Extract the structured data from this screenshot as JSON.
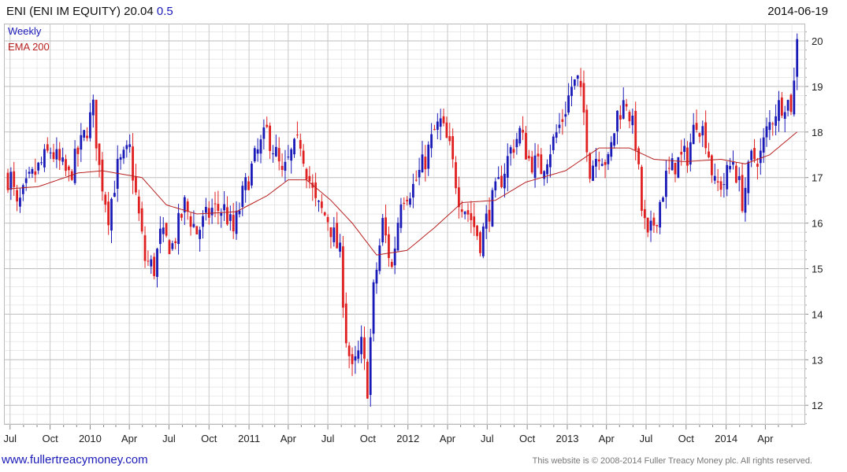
{
  "header": {
    "title": "ENI (ENI IM EQUITY) 20.04",
    "change": "0.5",
    "date": "2014-06-19"
  },
  "legend": {
    "weekly": "Weekly",
    "ema": "EMA 200"
  },
  "footer": {
    "website": "www.fullertreacymoney.com",
    "copyright": "This website is © 2008-2014 Fuller Treacy Money plc. All rights reserved."
  },
  "colors": {
    "up": "#1a1ab8",
    "down": "#e02020",
    "ema": "#b82020",
    "grid": "#dcdcdc"
  },
  "chart_data": {
    "type": "candlestick",
    "title": "ENI (ENI IM EQUITY) 20.04",
    "ylim": [
      11.5,
      20.3
    ],
    "y_ticks": [
      12,
      13,
      14,
      15,
      16,
      17,
      18,
      19,
      20
    ],
    "x_tick_labels": [
      "Jul",
      "Oct",
      "2010",
      "Apr",
      "Jul",
      "Oct",
      "2011",
      "Apr",
      "Jul",
      "Oct",
      "2012",
      "Apr",
      "Jul",
      "Oct",
      "2013",
      "Apr",
      "Jul",
      "Oct",
      "2014",
      "Apr"
    ],
    "x_range": [
      "2009-06-26",
      "2014-06-19"
    ],
    "grid": true,
    "legend_position": "top-left",
    "price_path": [
      [
        "2009-07-03",
        17.0
      ],
      [
        "2009-07-17",
        16.3
      ],
      [
        "2009-08-14",
        16.9
      ],
      [
        "2009-09-04",
        17.2
      ],
      [
        "2009-10-02",
        17.6
      ],
      [
        "2009-10-16",
        17.4
      ],
      [
        "2009-11-13",
        17.0
      ],
      [
        "2009-12-18",
        17.9
      ],
      [
        "2010-01-08",
        18.5
      ],
      [
        "2010-01-22",
        17.2
      ],
      [
        "2010-02-12",
        16.2
      ],
      [
        "2010-03-05",
        17.2
      ],
      [
        "2010-04-02",
        17.6
      ],
      [
        "2010-04-16",
        16.6
      ],
      [
        "2010-05-07",
        15.2
      ],
      [
        "2010-05-28",
        15.0
      ],
      [
        "2010-06-11",
        15.7
      ],
      [
        "2010-07-09",
        15.5
      ],
      [
        "2010-08-06",
        16.4
      ],
      [
        "2010-09-03",
        15.8
      ],
      [
        "2010-10-08",
        16.3
      ],
      [
        "2010-11-05",
        16.3
      ],
      [
        "2010-11-26",
        15.8
      ],
      [
        "2010-12-17",
        16.6
      ],
      [
        "2011-01-14",
        17.4
      ],
      [
        "2011-02-11",
        18.0
      ],
      [
        "2011-03-04",
        17.5
      ],
      [
        "2011-03-18",
        17.0
      ],
      [
        "2011-04-08",
        17.5
      ],
      [
        "2011-04-29",
        17.8
      ],
      [
        "2011-05-13",
        17.2
      ],
      [
        "2011-06-03",
        16.4
      ],
      [
        "2011-07-01",
        16.1
      ],
      [
        "2011-07-29",
        15.3
      ],
      [
        "2011-08-12",
        13.5
      ],
      [
        "2011-08-26",
        12.7
      ],
      [
        "2011-09-16",
        13.3
      ],
      [
        "2011-09-30",
        12.4
      ],
      [
        "2011-10-14",
        14.5
      ],
      [
        "2011-11-04",
        16.0
      ],
      [
        "2011-11-25",
        15.0
      ],
      [
        "2011-12-16",
        16.6
      ],
      [
        "2012-01-13",
        16.8
      ],
      [
        "2012-02-10",
        17.4
      ],
      [
        "2012-03-02",
        18.0
      ],
      [
        "2012-03-16",
        18.2
      ],
      [
        "2012-04-06",
        17.6
      ],
      [
        "2012-04-27",
        16.6
      ],
      [
        "2012-05-25",
        16.1
      ],
      [
        "2012-06-15",
        15.6
      ],
      [
        "2012-07-06",
        16.3
      ],
      [
        "2012-08-03",
        17.0
      ],
      [
        "2012-08-24",
        17.6
      ],
      [
        "2012-09-14",
        18.0
      ],
      [
        "2012-10-05",
        17.4
      ],
      [
        "2012-11-02",
        17.2
      ],
      [
        "2012-11-30",
        17.8
      ],
      [
        "2012-12-21",
        18.3
      ],
      [
        "2013-01-11",
        19.0
      ],
      [
        "2013-01-25",
        19.1
      ],
      [
        "2013-02-08",
        18.4
      ],
      [
        "2013-02-22",
        17.2
      ],
      [
        "2013-03-15",
        17.6
      ],
      [
        "2013-04-05",
        17.3
      ],
      [
        "2013-04-26",
        18.4
      ],
      [
        "2013-05-17",
        18.7
      ],
      [
        "2013-06-07",
        17.8
      ],
      [
        "2013-06-21",
        16.3
      ],
      [
        "2013-07-05",
        15.6
      ],
      [
        "2013-07-26",
        16.2
      ],
      [
        "2013-08-16",
        17.0
      ],
      [
        "2013-09-06",
        17.3
      ],
      [
        "2013-10-04",
        17.5
      ],
      [
        "2013-10-25",
        18.3
      ],
      [
        "2013-11-15",
        17.9
      ],
      [
        "2013-12-06",
        16.8
      ],
      [
        "2013-12-27",
        16.9
      ],
      [
        "2014-01-17",
        17.4
      ],
      [
        "2014-02-07",
        16.5
      ],
      [
        "2014-02-28",
        17.4
      ],
      [
        "2014-03-21",
        17.5
      ],
      [
        "2014-04-04",
        18.0
      ],
      [
        "2014-04-25",
        18.5
      ],
      [
        "2014-05-16",
        18.7
      ],
      [
        "2014-05-30",
        18.6
      ],
      [
        "2014-06-13",
        19.5
      ],
      [
        "2014-06-19",
        20.04
      ]
    ],
    "ema_path": [
      [
        "2009-06-26",
        16.75
      ],
      [
        "2009-09-04",
        16.8
      ],
      [
        "2009-12-04",
        17.1
      ],
      [
        "2010-01-29",
        17.15
      ],
      [
        "2010-04-30",
        17.0
      ],
      [
        "2010-06-25",
        16.4
      ],
      [
        "2010-09-03",
        16.2
      ],
      [
        "2010-12-03",
        16.25
      ],
      [
        "2011-02-11",
        16.6
      ],
      [
        "2011-04-01",
        16.95
      ],
      [
        "2011-05-13",
        16.95
      ],
      [
        "2011-07-08",
        16.5
      ],
      [
        "2011-08-26",
        16.0
      ],
      [
        "2011-10-21",
        15.3
      ],
      [
        "2011-12-30",
        15.4
      ],
      [
        "2012-03-02",
        15.9
      ],
      [
        "2012-05-04",
        16.45
      ],
      [
        "2012-07-20",
        16.5
      ],
      [
        "2012-09-28",
        16.9
      ],
      [
        "2012-12-28",
        17.15
      ],
      [
        "2013-03-15",
        17.65
      ],
      [
        "2013-05-24",
        17.65
      ],
      [
        "2013-07-19",
        17.4
      ],
      [
        "2013-09-27",
        17.35
      ],
      [
        "2013-12-20",
        17.4
      ],
      [
        "2014-02-14",
        17.3
      ],
      [
        "2014-04-11",
        17.5
      ],
      [
        "2014-06-19",
        18.05
      ]
    ]
  }
}
